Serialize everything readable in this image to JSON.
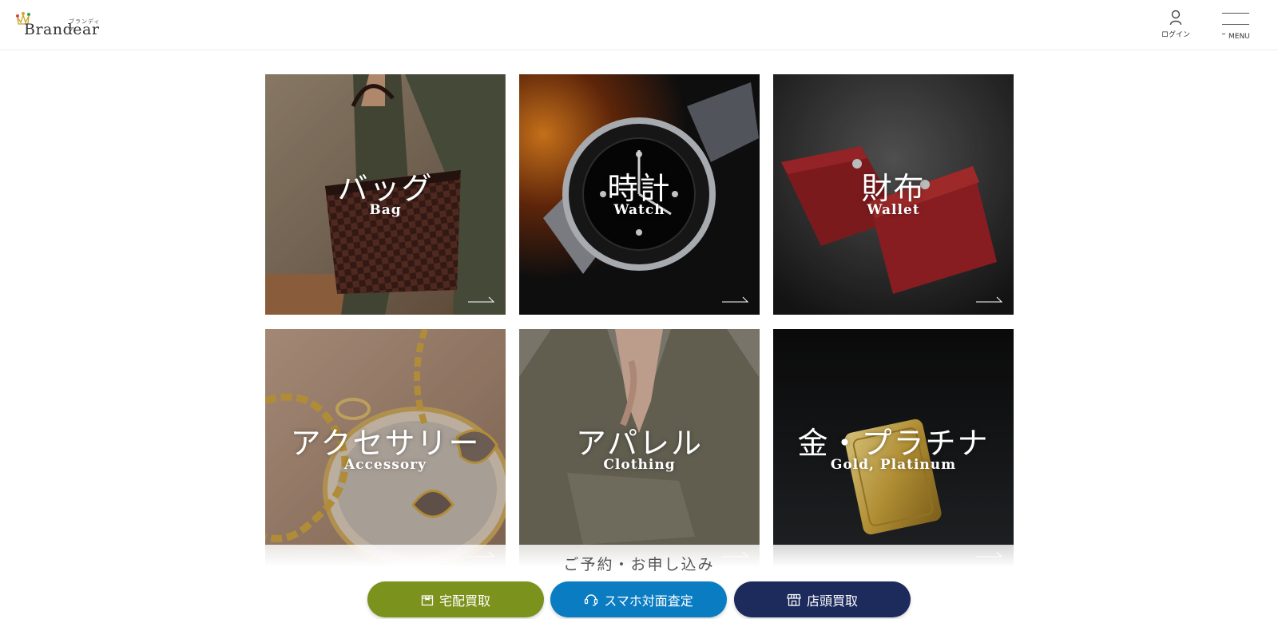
{
  "header": {
    "logo_text": "Brandear",
    "logo_ruby": "ブランディア",
    "login_label": "ログイン",
    "menu_label": "MENU"
  },
  "categories": [
    {
      "jp": "バッグ",
      "en": "Bag"
    },
    {
      "jp": "時計",
      "en": "Watch"
    },
    {
      "jp": "財布",
      "en": "Wallet"
    },
    {
      "jp": "アクセサリー",
      "en": "Accessory"
    },
    {
      "jp": "アパレル",
      "en": "Clothing"
    },
    {
      "jp": "金・プラチナ",
      "en": "Gold, Platinum"
    }
  ],
  "footer": {
    "reserve_label": "ご予約・お申し込み",
    "buttons": [
      {
        "label": "宅配買取",
        "color": "#7b921c",
        "icon": "box-icon"
      },
      {
        "label": "スマホ対面査定",
        "color": "#0a7cc2",
        "icon": "smartphone-chat-icon"
      },
      {
        "label": "店頭買取",
        "color": "#1c2a5c",
        "icon": "store-icon"
      }
    ]
  },
  "colors": {
    "delivery": "#7b921c",
    "online": "#0a7cc2",
    "store": "#1c2a5c"
  }
}
